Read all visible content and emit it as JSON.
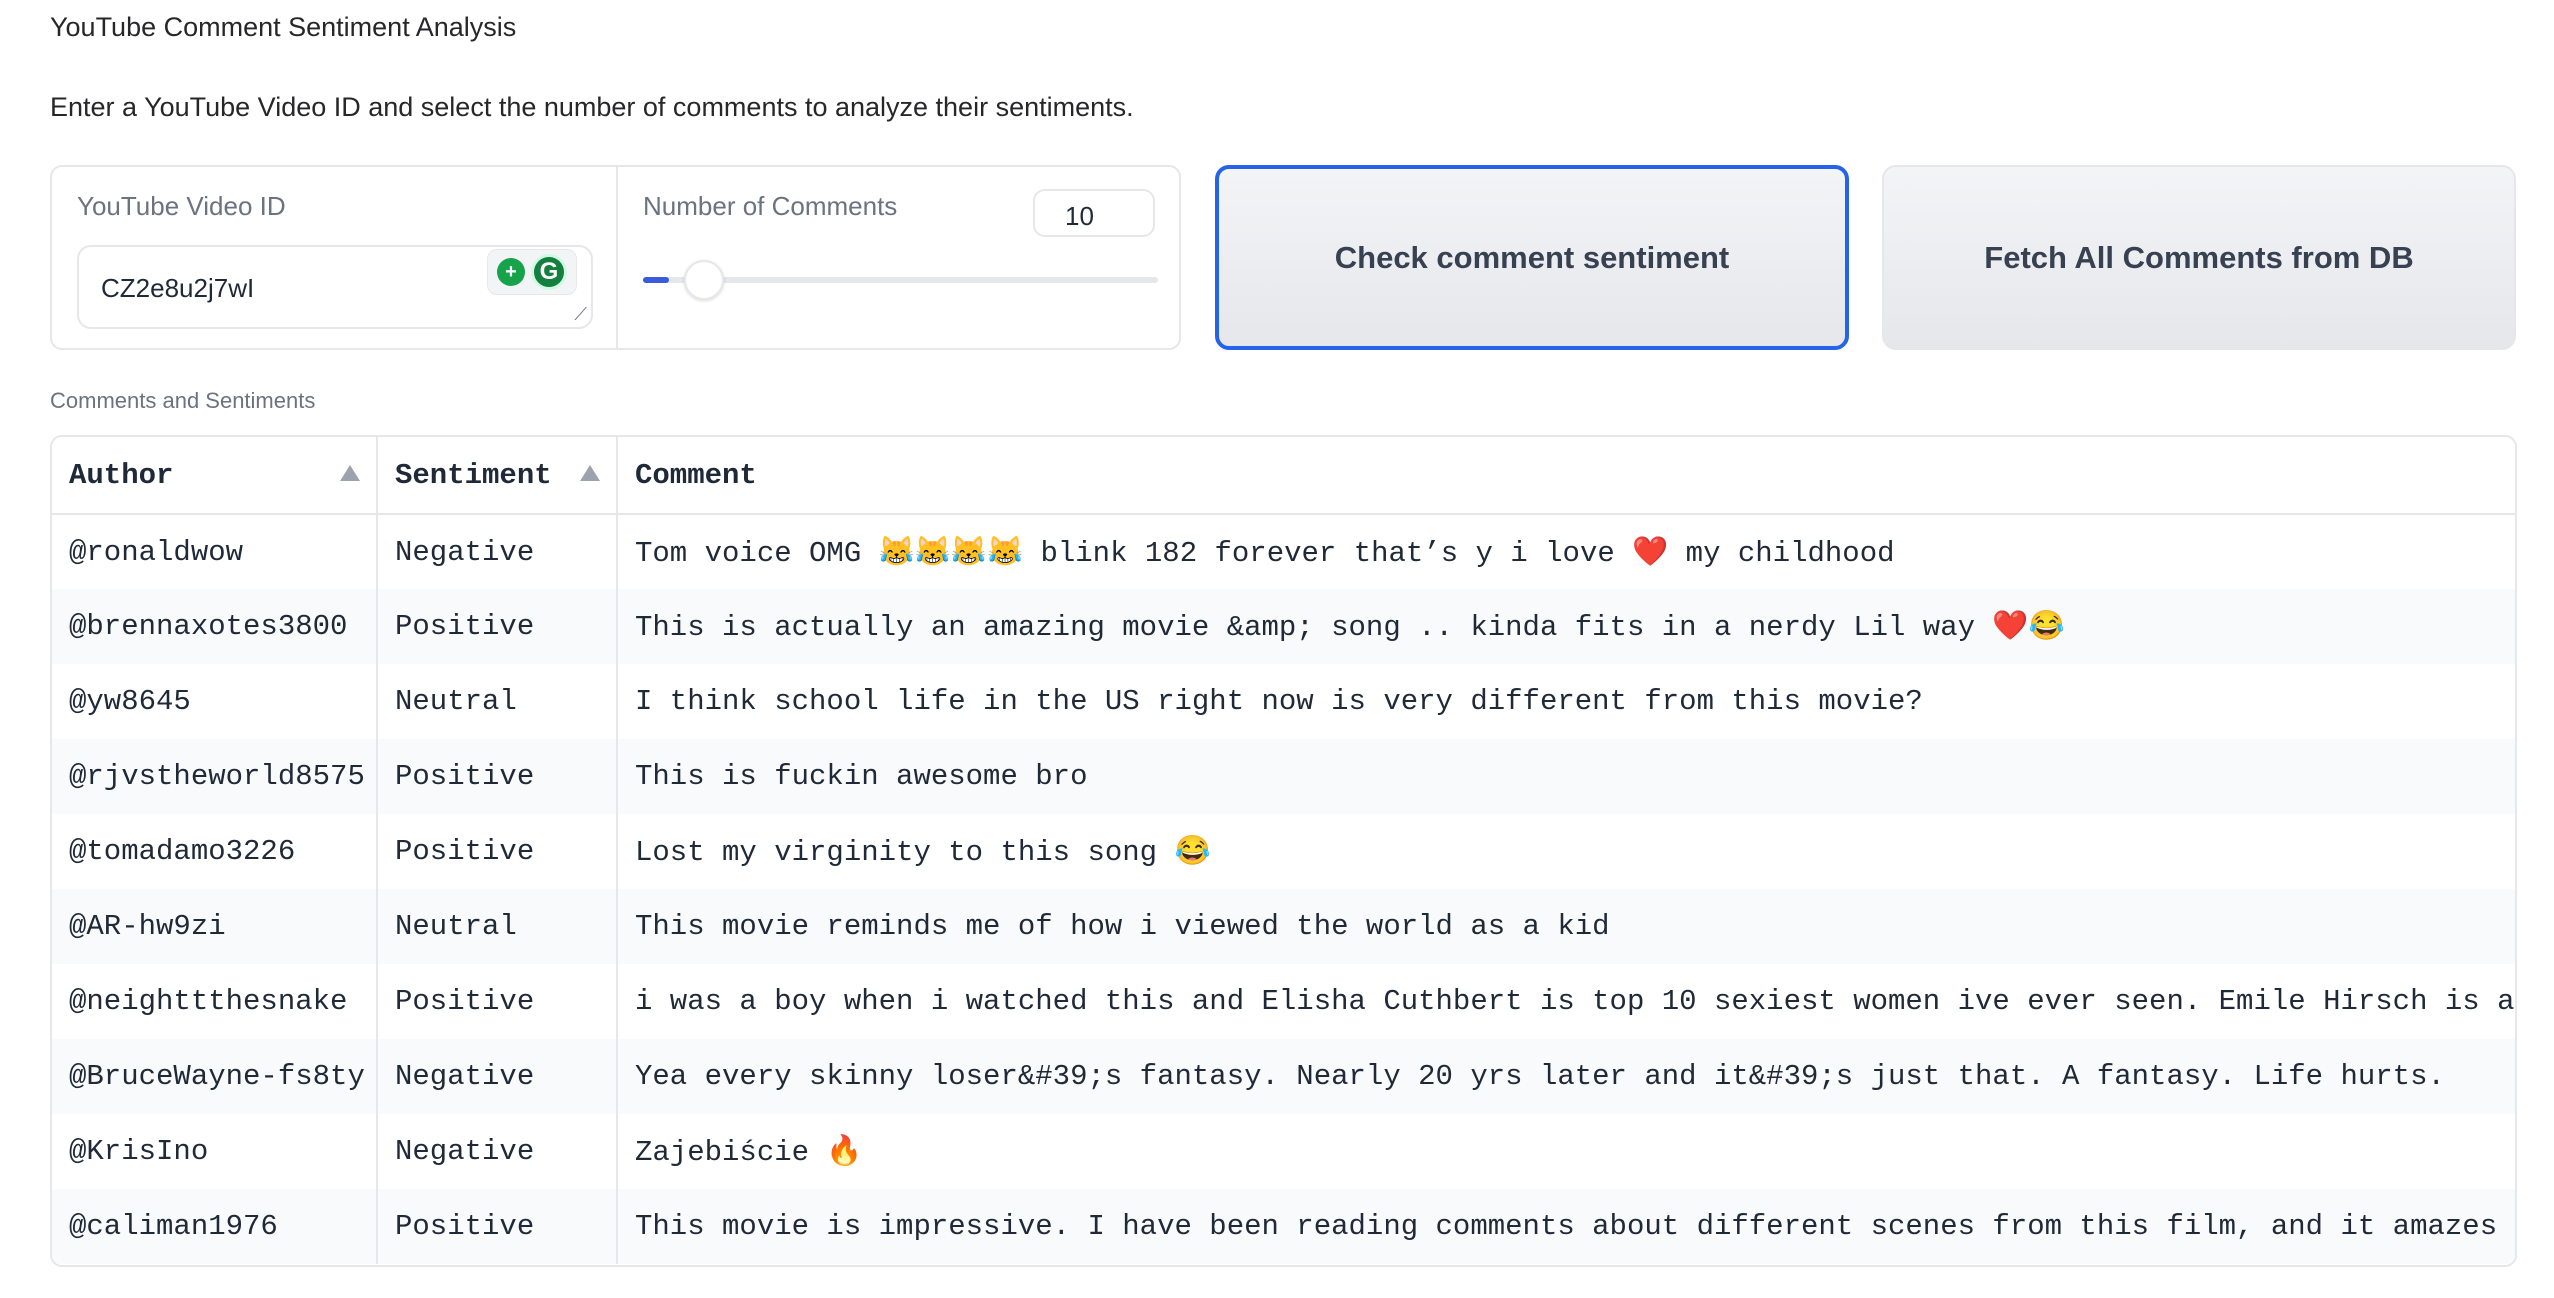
{
  "app": {
    "title": "YouTube Comment Sentiment Analysis",
    "description": "Enter a YouTube Video ID and select the number of comments to analyze their sentiments."
  },
  "form": {
    "video_id_label": "YouTube Video ID",
    "video_id_value": "CZ2e8u2j7wI",
    "num_comments_label": "Number of Comments",
    "num_comments_value": "10",
    "slider_fraction": 0.04
  },
  "buttons": {
    "check": "Check comment sentiment",
    "fetch": "Fetch All Comments from DB"
  },
  "results": {
    "label": "Comments and Sentiments",
    "columns": [
      "Author",
      "Sentiment",
      "Comment"
    ],
    "rows": [
      {
        "author": "@ronaldwow",
        "sentiment": "Negative",
        "comment": "Tom voice OMG 😹😹😹😹 blink 182 forever that’s y i love ❤️ my childhood"
      },
      {
        "author": "@brennaxotes3800",
        "sentiment": "Positive",
        "comment": "This is actually an amazing movie &amp; song .. kinda fits in a nerdy Lil way ❤️😂"
      },
      {
        "author": "@yw8645",
        "sentiment": "Neutral",
        "comment": "I think school life in the US right now is very different from this movie?"
      },
      {
        "author": "@rjvstheworld8575",
        "sentiment": "Positive",
        "comment": "This is fuckin awesome bro"
      },
      {
        "author": "@tomadamo3226",
        "sentiment": "Positive",
        "comment": "Lost my virginity to this song 😂"
      },
      {
        "author": "@AR-hw9zi",
        "sentiment": "Neutral",
        "comment": "This movie reminds me of how i viewed the world as a kid"
      },
      {
        "author": "@neighttthesnake",
        "sentiment": "Positive",
        "comment": "i was a boy when i watched this and Elisha Cuthbert is top 10 sexiest women ive ever seen. Emile Hirsch is a su"
      },
      {
        "author": "@BruceWayne-fs8ty",
        "sentiment": "Negative",
        "comment": "Yea every skinny loser&#39;s fantasy. Nearly 20 yrs later and it&#39;s just that. A fantasy. Life hurts."
      },
      {
        "author": "@KrisIno",
        "sentiment": "Negative",
        "comment": "Zajebiście 🔥"
      },
      {
        "author": "@caliman1976",
        "sentiment": "Positive",
        "comment": "This movie is impressive. I have been reading comments about different scenes from this film, and it amazes me"
      }
    ]
  }
}
